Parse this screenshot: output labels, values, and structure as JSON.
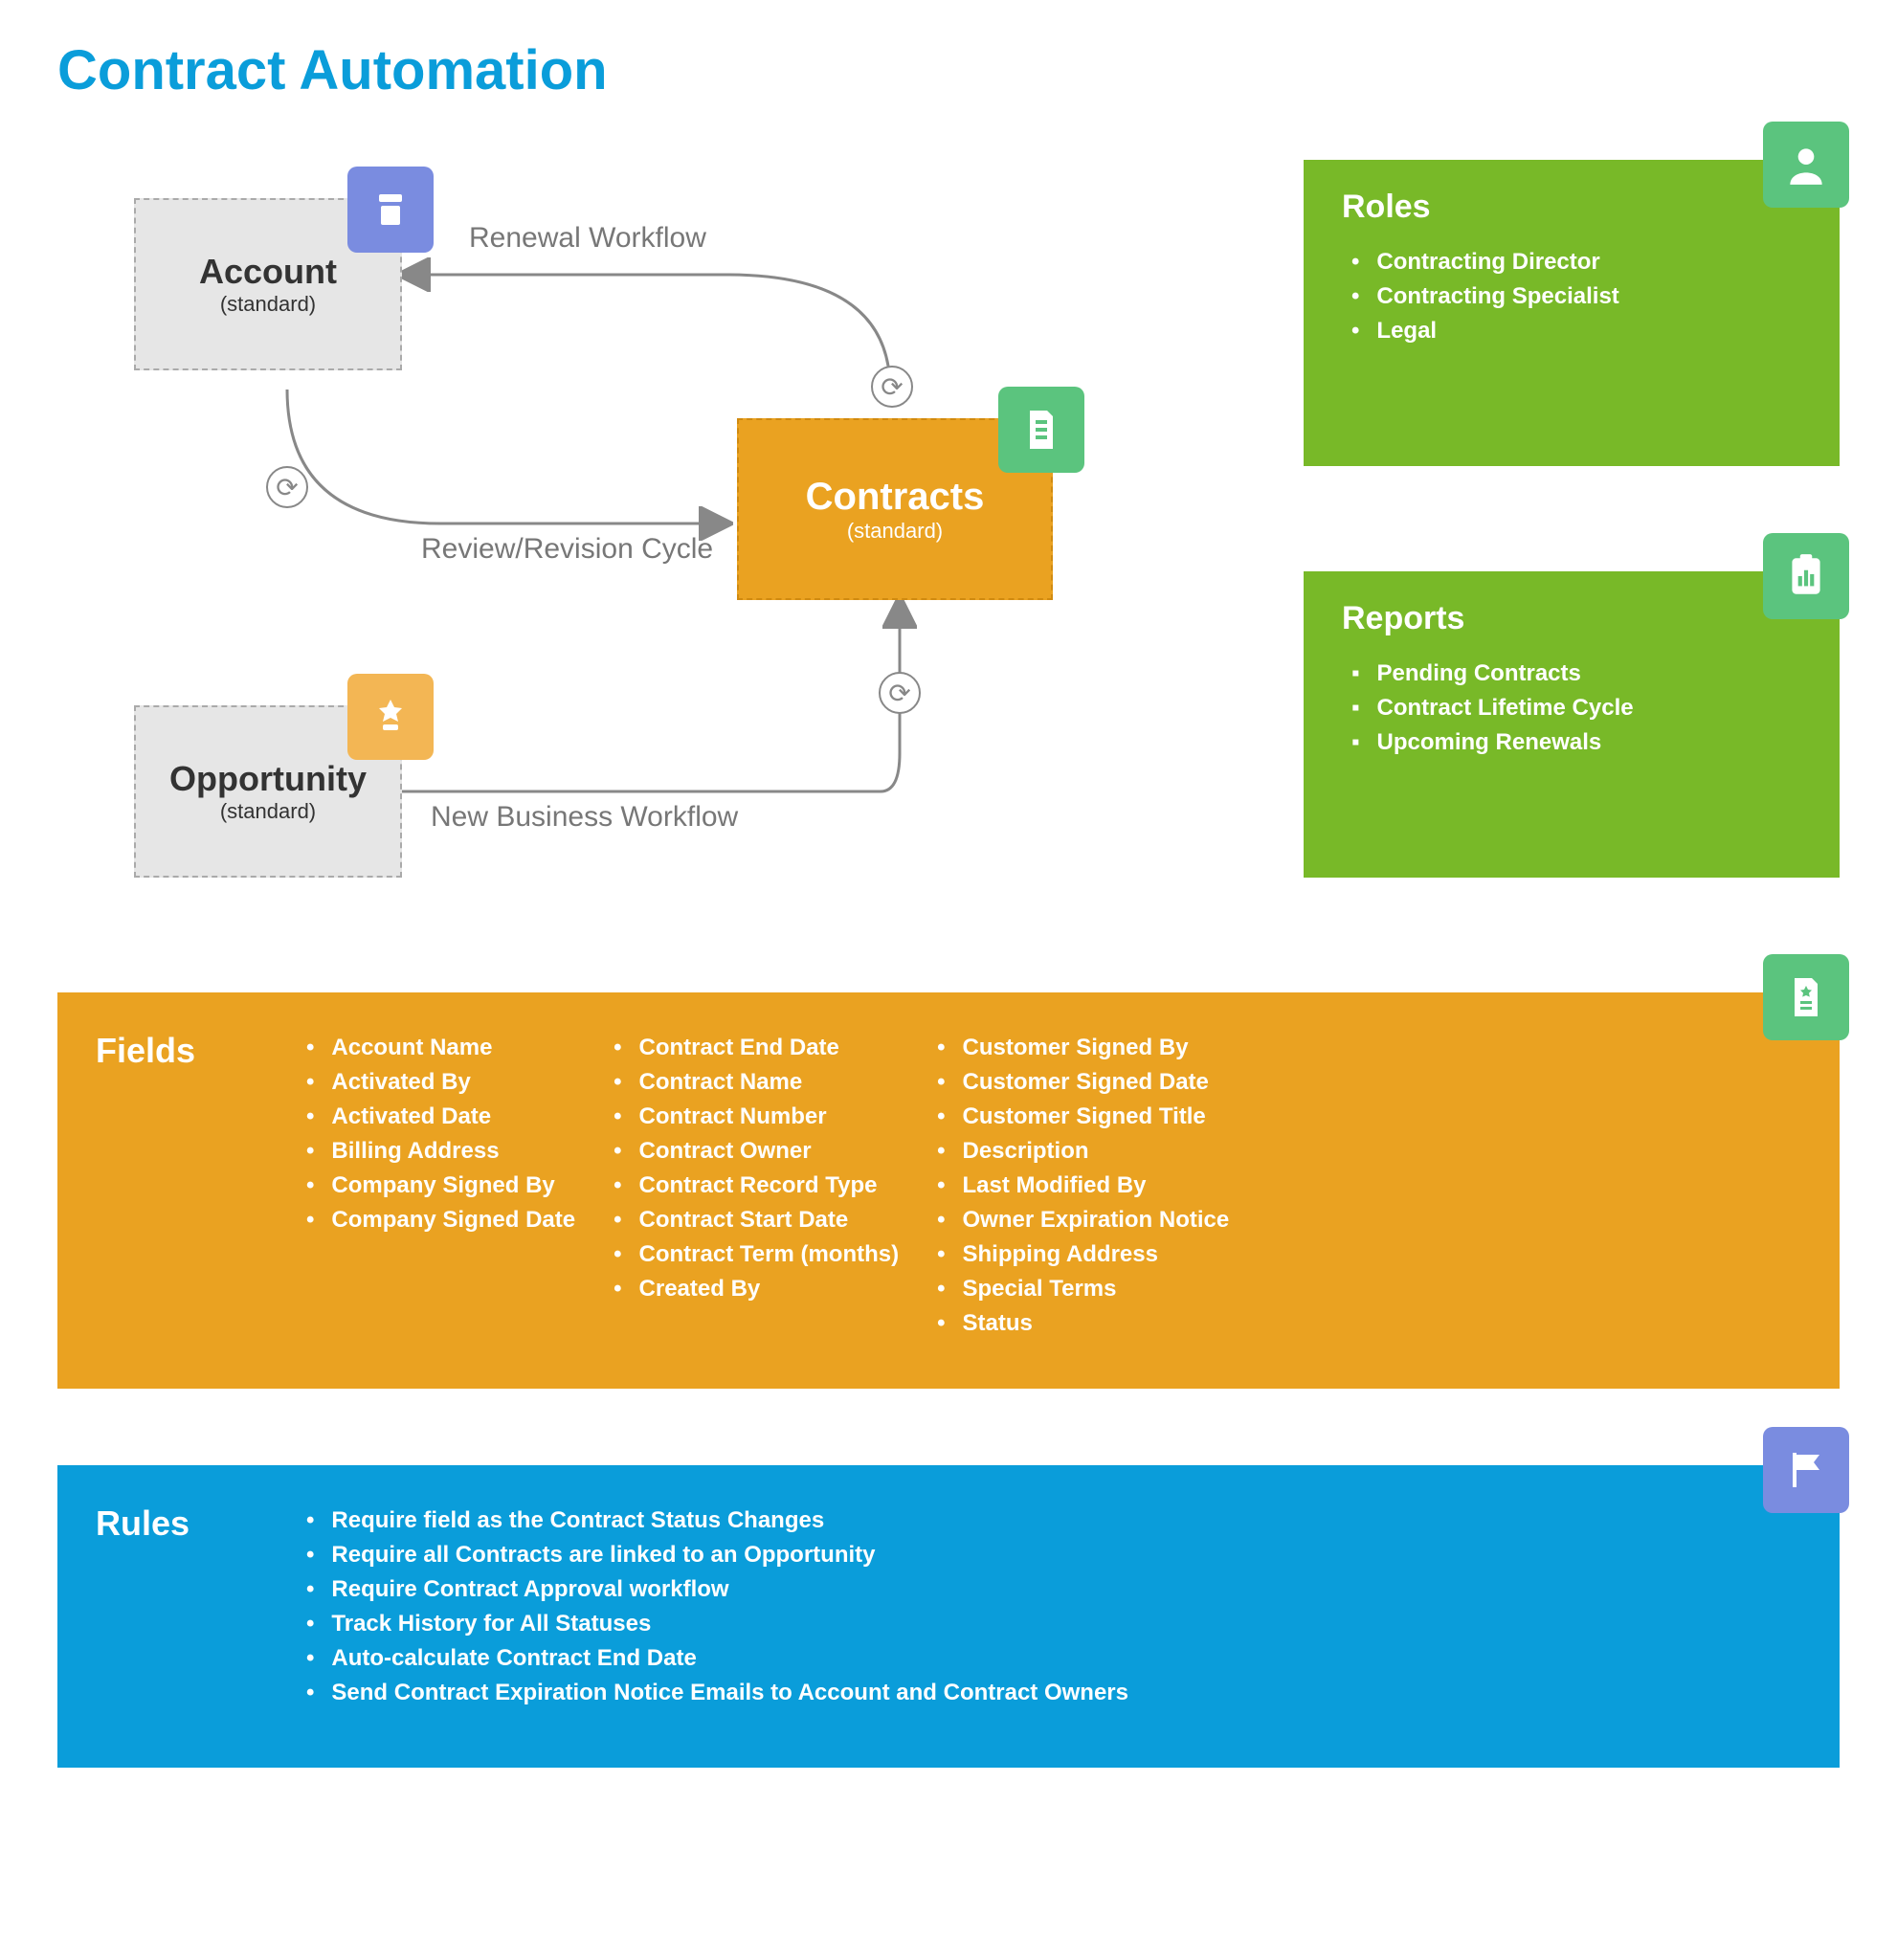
{
  "title": "Contract Automation",
  "objects": {
    "account": {
      "name": "Account",
      "subtitle": "(standard)"
    },
    "opportunity": {
      "name": "Opportunity",
      "subtitle": "(standard)"
    },
    "contracts": {
      "name": "Contracts",
      "subtitle": "(standard)"
    }
  },
  "flows": {
    "renewal": "Renewal  Workflow",
    "review": "Review/Revision Cycle",
    "newbiz": "New Business Workflow"
  },
  "roles": {
    "title": "Roles",
    "items": [
      "Contracting Director",
      "Contracting Specialist",
      "Legal"
    ]
  },
  "reports": {
    "title": "Reports",
    "items": [
      "Pending Contracts",
      "Contract Lifetime Cycle",
      "Upcoming Renewals"
    ]
  },
  "fields": {
    "title": "Fields",
    "col1": [
      "Account Name",
      "Activated By",
      "Activated Date",
      "Billing Address",
      "Company Signed By",
      "Company Signed Date"
    ],
    "col2": [
      "Contract End Date",
      "Contract Name",
      "Contract Number",
      "Contract Owner",
      "Contract Record Type",
      "Contract Start Date",
      "Contract Term (months)",
      "Created By"
    ],
    "col3": [
      "Customer Signed By",
      "Customer Signed Date",
      "Customer Signed Title",
      "Description",
      "Last Modified By",
      "Owner Expiration Notice",
      "Shipping Address",
      "Special Terms",
      "Status"
    ]
  },
  "rules": {
    "title": "Rules",
    "items": [
      "Require field as the Contract Status Changes",
      "Require all Contracts are linked to an Opportunity",
      "Require  Contract Approval workflow",
      "Track History for All Statuses",
      "Auto-calculate Contract End Date",
      "Send Contract Expiration Notice Emails to Account and Contract Owners"
    ]
  }
}
